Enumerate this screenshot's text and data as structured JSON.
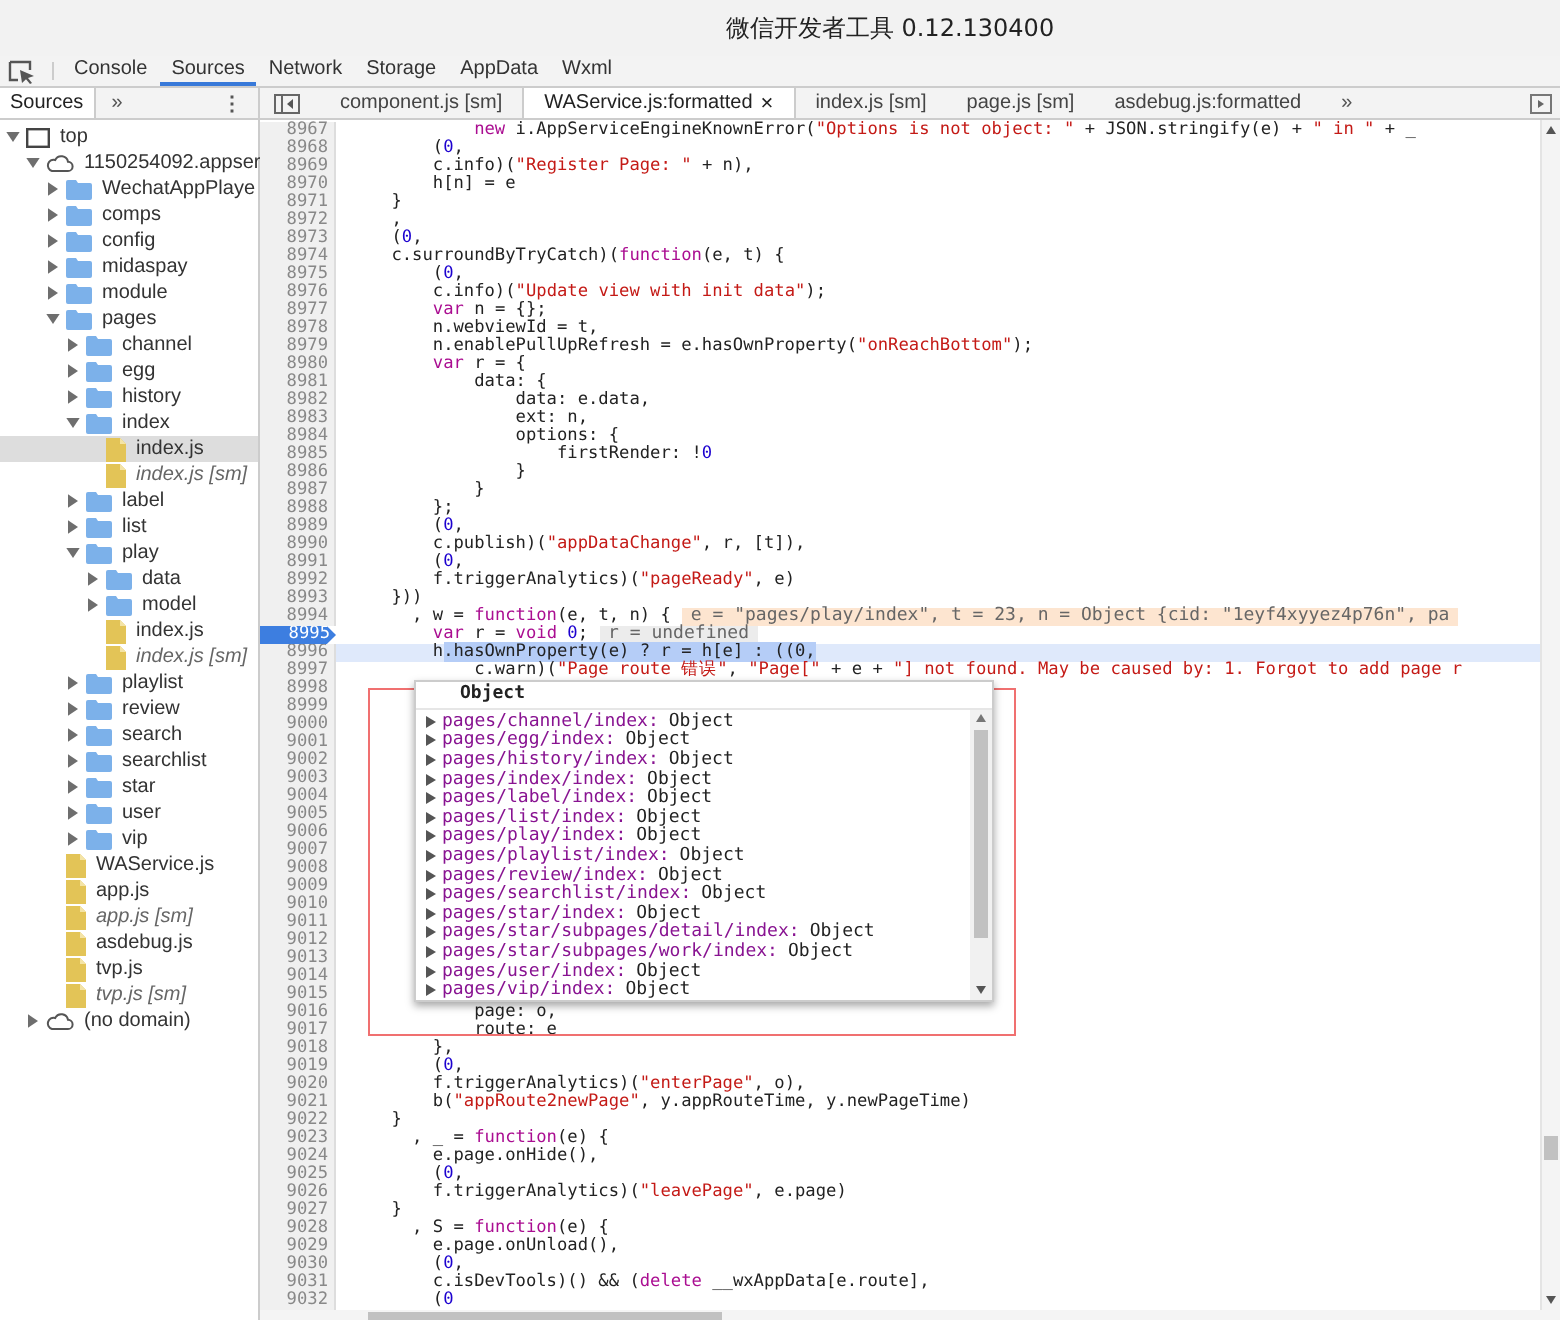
{
  "window": {
    "title": "微信开发者工具 0.12.130400"
  },
  "toolbar": {
    "tabs": [
      {
        "label": "Console",
        "selected": false
      },
      {
        "label": "Sources",
        "selected": true
      },
      {
        "label": "Network",
        "selected": false
      },
      {
        "label": "Storage",
        "selected": false
      },
      {
        "label": "AppData",
        "selected": false
      },
      {
        "label": "Wxml",
        "selected": false
      }
    ]
  },
  "navigator": {
    "tabs": [
      {
        "label": "Sources",
        "selected": true
      }
    ],
    "more": "»",
    "menu": "⋮",
    "tree": [
      {
        "label": "top",
        "kind": "frame",
        "expanded": true,
        "selected": false,
        "children": [
          {
            "label": "1150254092.appser",
            "kind": "domain",
            "expanded": true,
            "selected": false,
            "children": [
              {
                "label": "WechatAppPlaye",
                "kind": "folder",
                "expanded": false,
                "selected": false
              },
              {
                "label": "comps",
                "kind": "folder",
                "expanded": false,
                "selected": false
              },
              {
                "label": "config",
                "kind": "folder",
                "expanded": false,
                "selected": false
              },
              {
                "label": "midaspay",
                "kind": "folder",
                "expanded": false,
                "selected": false
              },
              {
                "label": "module",
                "kind": "folder",
                "expanded": false,
                "selected": false
              },
              {
                "label": "pages",
                "kind": "folder",
                "expanded": true,
                "selected": false,
                "children": [
                  {
                    "label": "channel",
                    "kind": "folder",
                    "expanded": false,
                    "selected": false
                  },
                  {
                    "label": "egg",
                    "kind": "folder",
                    "expanded": false,
                    "selected": false
                  },
                  {
                    "label": "history",
                    "kind": "folder",
                    "expanded": false,
                    "selected": false
                  },
                  {
                    "label": "index",
                    "kind": "folder",
                    "expanded": true,
                    "selected": false,
                    "children": [
                      {
                        "label": "index.js",
                        "kind": "file",
                        "selected": true
                      },
                      {
                        "label": "index.js [sm]",
                        "kind": "mapped-file",
                        "selected": false
                      }
                    ]
                  },
                  {
                    "label": "label",
                    "kind": "folder",
                    "expanded": false,
                    "selected": false
                  },
                  {
                    "label": "list",
                    "kind": "folder",
                    "expanded": false,
                    "selected": false
                  },
                  {
                    "label": "play",
                    "kind": "folder",
                    "expanded": true,
                    "selected": false,
                    "children": [
                      {
                        "label": "data",
                        "kind": "folder",
                        "expanded": false,
                        "selected": false
                      },
                      {
                        "label": "model",
                        "kind": "folder",
                        "expanded": false,
                        "selected": false
                      },
                      {
                        "label": "index.js",
                        "kind": "file",
                        "selected": false
                      },
                      {
                        "label": "index.js [sm]",
                        "kind": "mapped-file",
                        "selected": false
                      }
                    ]
                  },
                  {
                    "label": "playlist",
                    "kind": "folder",
                    "expanded": false,
                    "selected": false
                  },
                  {
                    "label": "review",
                    "kind": "folder",
                    "expanded": false,
                    "selected": false
                  },
                  {
                    "label": "search",
                    "kind": "folder",
                    "expanded": false,
                    "selected": false
                  },
                  {
                    "label": "searchlist",
                    "kind": "folder",
                    "expanded": false,
                    "selected": false
                  },
                  {
                    "label": "star",
                    "kind": "folder",
                    "expanded": false,
                    "selected": false
                  },
                  {
                    "label": "user",
                    "kind": "folder",
                    "expanded": false,
                    "selected": false
                  },
                  {
                    "label": "vip",
                    "kind": "folder",
                    "expanded": false,
                    "selected": false
                  }
                ]
              },
              {
                "label": "WAService.js",
                "kind": "file",
                "selected": false
              },
              {
                "label": "app.js",
                "kind": "file",
                "selected": false
              },
              {
                "label": "app.js [sm]",
                "kind": "mapped-file",
                "selected": false
              },
              {
                "label": "asdebug.js",
                "kind": "file",
                "selected": false
              },
              {
                "label": "tvp.js",
                "kind": "file",
                "selected": false
              },
              {
                "label": "tvp.js [sm]",
                "kind": "mapped-file",
                "selected": false
              }
            ]
          },
          {
            "label": "(no domain)",
            "kind": "domain",
            "expanded": false,
            "selected": false
          }
        ]
      }
    ]
  },
  "editor": {
    "tabs": [
      {
        "label": "component.js [sm]",
        "selected": false
      },
      {
        "label": "WAService.js:formatted",
        "selected": true,
        "close": "×"
      },
      {
        "label": "index.js [sm]",
        "selected": false
      },
      {
        "label": "page.js [sm]",
        "selected": false
      },
      {
        "label": "asdebug.js:formatted",
        "selected": false
      }
    ],
    "more": "»",
    "lines": [
      {
        "number": "8967",
        "breakpoint": false,
        "current": false,
        "tokens": [
          {
            "kind": "keyword",
            "text": "            new"
          },
          {
            "kind": "plain",
            "text": " i.AppServiceEngineKnownError("
          },
          {
            "kind": "string",
            "text": "\"Options is not object: \""
          },
          {
            "kind": "plain",
            "text": " + JSON.stringify(e) + "
          },
          {
            "kind": "string",
            "text": "\" in \""
          },
          {
            "kind": "plain",
            "text": " + _"
          }
        ]
      },
      {
        "number": "8968",
        "breakpoint": false,
        "current": false,
        "tokens": [
          {
            "kind": "plain",
            "text": "        ("
          },
          {
            "kind": "number",
            "text": "0"
          },
          {
            "kind": "plain",
            "text": ","
          }
        ]
      },
      {
        "number": "8969",
        "breakpoint": false,
        "current": false,
        "tokens": [
          {
            "kind": "plain",
            "text": "        c.info)("
          },
          {
            "kind": "string",
            "text": "\"Register Page: \""
          },
          {
            "kind": "plain",
            "text": " + n),"
          }
        ]
      },
      {
        "number": "8970",
        "breakpoint": false,
        "current": false,
        "tokens": [
          {
            "kind": "plain",
            "text": "        h[n] = e"
          }
        ]
      },
      {
        "number": "8971",
        "breakpoint": false,
        "current": false,
        "tokens": [
          {
            "kind": "plain",
            "text": "    }"
          }
        ]
      },
      {
        "number": "8972",
        "breakpoint": false,
        "current": false,
        "tokens": [
          {
            "kind": "plain",
            "text": "    ,"
          }
        ]
      },
      {
        "number": "8973",
        "breakpoint": false,
        "current": false,
        "tokens": [
          {
            "kind": "plain",
            "text": "    ("
          },
          {
            "kind": "number",
            "text": "0"
          },
          {
            "kind": "plain",
            "text": ","
          }
        ]
      },
      {
        "number": "8974",
        "breakpoint": false,
        "current": false,
        "tokens": [
          {
            "kind": "plain",
            "text": "    c.surroundByTryCatch)("
          },
          {
            "kind": "keyword",
            "text": "function"
          },
          {
            "kind": "plain",
            "text": "(e, t) {"
          }
        ]
      },
      {
        "number": "8975",
        "breakpoint": false,
        "current": false,
        "tokens": [
          {
            "kind": "plain",
            "text": "        ("
          },
          {
            "kind": "number",
            "text": "0"
          },
          {
            "kind": "plain",
            "text": ","
          }
        ]
      },
      {
        "number": "8976",
        "breakpoint": false,
        "current": false,
        "tokens": [
          {
            "kind": "plain",
            "text": "        c.info)("
          },
          {
            "kind": "string",
            "text": "\"Update view with init data\""
          },
          {
            "kind": "plain",
            "text": ");"
          }
        ]
      },
      {
        "number": "8977",
        "breakpoint": false,
        "current": false,
        "tokens": [
          {
            "kind": "keyword",
            "text": "        var"
          },
          {
            "kind": "plain",
            "text": " n = {};"
          }
        ]
      },
      {
        "number": "8978",
        "breakpoint": false,
        "current": false,
        "tokens": [
          {
            "kind": "plain",
            "text": "        n.webviewId = t,"
          }
        ]
      },
      {
        "number": "8979",
        "breakpoint": false,
        "current": false,
        "tokens": [
          {
            "kind": "plain",
            "text": "        n.enablePullUpRefresh = e.hasOwnProperty("
          },
          {
            "kind": "string",
            "text": "\"onReachBottom\""
          },
          {
            "kind": "plain",
            "text": ");"
          }
        ]
      },
      {
        "number": "8980",
        "breakpoint": false,
        "current": false,
        "tokens": [
          {
            "kind": "keyword",
            "text": "        var"
          },
          {
            "kind": "plain",
            "text": " r = {"
          }
        ]
      },
      {
        "number": "8981",
        "breakpoint": false,
        "current": false,
        "tokens": [
          {
            "kind": "plain",
            "text": "            data: {"
          }
        ]
      },
      {
        "number": "8982",
        "breakpoint": false,
        "current": false,
        "tokens": [
          {
            "kind": "plain",
            "text": "                data: e.data,"
          }
        ]
      },
      {
        "number": "8983",
        "breakpoint": false,
        "current": false,
        "tokens": [
          {
            "kind": "plain",
            "text": "                ext: n,"
          }
        ]
      },
      {
        "number": "8984",
        "breakpoint": false,
        "current": false,
        "tokens": [
          {
            "kind": "plain",
            "text": "                options: {"
          }
        ]
      },
      {
        "number": "8985",
        "breakpoint": false,
        "current": false,
        "tokens": [
          {
            "kind": "plain",
            "text": "                    firstRender: !"
          },
          {
            "kind": "number",
            "text": "0"
          }
        ]
      },
      {
        "number": "8986",
        "breakpoint": false,
        "current": false,
        "tokens": [
          {
            "kind": "plain",
            "text": "                }"
          }
        ]
      },
      {
        "number": "8987",
        "breakpoint": false,
        "current": false,
        "tokens": [
          {
            "kind": "plain",
            "text": "            }"
          }
        ]
      },
      {
        "number": "8988",
        "breakpoint": false,
        "current": false,
        "tokens": [
          {
            "kind": "plain",
            "text": "        };"
          }
        ]
      },
      {
        "number": "8989",
        "breakpoint": false,
        "current": false,
        "tokens": [
          {
            "kind": "plain",
            "text": "        ("
          },
          {
            "kind": "number",
            "text": "0"
          },
          {
            "kind": "plain",
            "text": ","
          }
        ]
      },
      {
        "number": "8990",
        "breakpoint": false,
        "current": false,
        "tokens": [
          {
            "kind": "plain",
            "text": "        c.publish)("
          },
          {
            "kind": "string",
            "text": "\"appDataChange\""
          },
          {
            "kind": "plain",
            "text": ", r, [t]),"
          }
        ]
      },
      {
        "number": "8991",
        "breakpoint": false,
        "current": false,
        "tokens": [
          {
            "kind": "plain",
            "text": "        ("
          },
          {
            "kind": "number",
            "text": "0"
          },
          {
            "kind": "plain",
            "text": ","
          }
        ]
      },
      {
        "number": "8992",
        "breakpoint": false,
        "current": false,
        "tokens": [
          {
            "kind": "plain",
            "text": "        f.triggerAnalytics)("
          },
          {
            "kind": "string",
            "text": "\"pageReady\""
          },
          {
            "kind": "plain",
            "text": ", e)"
          }
        ]
      },
      {
        "number": "8993",
        "breakpoint": false,
        "current": false,
        "tokens": [
          {
            "kind": "plain",
            "text": "    }))"
          }
        ]
      },
      {
        "number": "8994",
        "breakpoint": false,
        "current": false,
        "tokens": [
          {
            "kind": "plain",
            "text": "      , w = "
          },
          {
            "kind": "keyword",
            "text": "function"
          },
          {
            "kind": "plain",
            "text": "(e, t, n) {"
          }
        ],
        "annotation": {
          "kind": "arguments",
          "text": "e = \"pages/play/index\", t = 23, n = Object {cid: \"1eyf4xyyez4p76n\", pa"
        }
      },
      {
        "number": "8995",
        "breakpoint": true,
        "current": false,
        "tokens": [
          {
            "kind": "keyword",
            "text": "        var"
          },
          {
            "kind": "plain",
            "text": " r = "
          },
          {
            "kind": "keyword",
            "text": "void "
          },
          {
            "kind": "number",
            "text": "0"
          },
          {
            "kind": "plain",
            "text": ";"
          }
        ],
        "annotation": {
          "kind": "value",
          "text": "r = undefined"
        }
      },
      {
        "number": "8996",
        "breakpoint": false,
        "current": true,
        "tokens": [
          {
            "kind": "plain",
            "text": "        h"
          },
          {
            "kind": "selection",
            "text": ".hasOwnProperty(e) ? r = h[e] : ((0,"
          }
        ]
      },
      {
        "number": "8997",
        "breakpoint": false,
        "current": false,
        "tokens": [
          {
            "kind": "plain",
            "text": "            c.warn)("
          },
          {
            "kind": "string",
            "text": "\"Page route 错误\""
          },
          {
            "kind": "plain",
            "text": ", "
          },
          {
            "kind": "string",
            "text": "\"Page[\""
          },
          {
            "kind": "plain",
            "text": " + e + "
          },
          {
            "kind": "string",
            "text": "\"] not found. May be caused by: 1. Forgot to add page r"
          }
        ]
      },
      {
        "number": "8998",
        "breakpoint": false,
        "current": false
      },
      {
        "number": "8999",
        "breakpoint": false,
        "current": false
      },
      {
        "number": "9000",
        "breakpoint": false,
        "current": false
      },
      {
        "number": "9001",
        "breakpoint": false,
        "current": false
      },
      {
        "number": "9002",
        "breakpoint": false,
        "current": false
      },
      {
        "number": "9003",
        "breakpoint": false,
        "current": false
      },
      {
        "number": "9004",
        "breakpoint": false,
        "current": false
      },
      {
        "number": "9005",
        "breakpoint": false,
        "current": false
      },
      {
        "number": "9006",
        "breakpoint": false,
        "current": false
      },
      {
        "number": "9007",
        "breakpoint": false,
        "current": false
      },
      {
        "number": "9008",
        "breakpoint": false,
        "current": false
      },
      {
        "number": "9009",
        "breakpoint": false,
        "current": false
      },
      {
        "number": "9010",
        "breakpoint": false,
        "current": false
      },
      {
        "number": "9011",
        "breakpoint": false,
        "current": false
      },
      {
        "number": "9012",
        "breakpoint": false,
        "current": false
      },
      {
        "number": "9013",
        "breakpoint": false,
        "current": false
      },
      {
        "number": "9014",
        "breakpoint": false,
        "current": false
      },
      {
        "number": "9015",
        "breakpoint": false,
        "current": false
      },
      {
        "number": "9016",
        "breakpoint": false,
        "current": false,
        "tokens": [
          {
            "kind": "plain",
            "text": "            page: o,"
          }
        ]
      },
      {
        "number": "9017",
        "breakpoint": false,
        "current": false,
        "tokens": [
          {
            "kind": "plain",
            "text": "            route: e"
          }
        ]
      },
      {
        "number": "9018",
        "breakpoint": false,
        "current": false,
        "tokens": [
          {
            "kind": "plain",
            "text": "        },"
          }
        ]
      },
      {
        "number": "9019",
        "breakpoint": false,
        "current": false,
        "tokens": [
          {
            "kind": "plain",
            "text": "        ("
          },
          {
            "kind": "number",
            "text": "0"
          },
          {
            "kind": "plain",
            "text": ","
          }
        ]
      },
      {
        "number": "9020",
        "breakpoint": false,
        "current": false,
        "tokens": [
          {
            "kind": "plain",
            "text": "        f.triggerAnalytics)("
          },
          {
            "kind": "string",
            "text": "\"enterPage\""
          },
          {
            "kind": "plain",
            "text": ", o),"
          }
        ]
      },
      {
        "number": "9021",
        "breakpoint": false,
        "current": false,
        "tokens": [
          {
            "kind": "plain",
            "text": "        b("
          },
          {
            "kind": "string",
            "text": "\"appRoute2newPage\""
          },
          {
            "kind": "plain",
            "text": ", y.appRouteTime, y.newPageTime)"
          }
        ]
      },
      {
        "number": "9022",
        "breakpoint": false,
        "current": false,
        "tokens": [
          {
            "kind": "plain",
            "text": "    }"
          }
        ]
      },
      {
        "number": "9023",
        "breakpoint": false,
        "current": false,
        "tokens": [
          {
            "kind": "plain",
            "text": "      , _ = "
          },
          {
            "kind": "keyword",
            "text": "function"
          },
          {
            "kind": "plain",
            "text": "(e) {"
          }
        ]
      },
      {
        "number": "9024",
        "breakpoint": false,
        "current": false,
        "tokens": [
          {
            "kind": "plain",
            "text": "        e.page.onHide(),"
          }
        ]
      },
      {
        "number": "9025",
        "breakpoint": false,
        "current": false,
        "tokens": [
          {
            "kind": "plain",
            "text": "        ("
          },
          {
            "kind": "number",
            "text": "0"
          },
          {
            "kind": "plain",
            "text": ","
          }
        ]
      },
      {
        "number": "9026",
        "breakpoint": false,
        "current": false,
        "tokens": [
          {
            "kind": "plain",
            "text": "        f.triggerAnalytics)("
          },
          {
            "kind": "string",
            "text": "\"leavePage\""
          },
          {
            "kind": "plain",
            "text": ", e.page)"
          }
        ]
      },
      {
        "number": "9027",
        "breakpoint": false,
        "current": false,
        "tokens": [
          {
            "kind": "plain",
            "text": "    }"
          }
        ]
      },
      {
        "number": "9028",
        "breakpoint": false,
        "current": false,
        "tokens": [
          {
            "kind": "plain",
            "text": "      , S = "
          },
          {
            "kind": "keyword",
            "text": "function"
          },
          {
            "kind": "plain",
            "text": "(e) {"
          }
        ]
      },
      {
        "number": "9029",
        "breakpoint": false,
        "current": false,
        "tokens": [
          {
            "kind": "plain",
            "text": "        e.page.onUnload(),"
          }
        ]
      },
      {
        "number": "9030",
        "breakpoint": false,
        "current": false,
        "tokens": [
          {
            "kind": "plain",
            "text": "        ("
          },
          {
            "kind": "number",
            "text": "0"
          },
          {
            "kind": "plain",
            "text": ","
          }
        ]
      },
      {
        "number": "9031",
        "breakpoint": false,
        "current": false,
        "tokens": [
          {
            "kind": "plain",
            "text": "        c.isDevTools)() && ("
          },
          {
            "kind": "keyword",
            "text": "delete"
          },
          {
            "kind": "plain",
            "text": " __wxAppData[e.route],"
          }
        ]
      },
      {
        "number": "9032",
        "breakpoint": false,
        "current": false,
        "tokens": [
          {
            "kind": "plain",
            "text": "        ("
          },
          {
            "kind": "number",
            "text": "0"
          }
        ]
      }
    ],
    "popup": {
      "title": "Object",
      "rows": [
        {
          "key": "pages/channel/index:",
          "value": "Object"
        },
        {
          "key": "pages/egg/index:",
          "value": "Object"
        },
        {
          "key": "pages/history/index:",
          "value": "Object"
        },
        {
          "key": "pages/index/index:",
          "value": "Object"
        },
        {
          "key": "pages/label/index:",
          "value": "Object"
        },
        {
          "key": "pages/list/index:",
          "value": "Object"
        },
        {
          "key": "pages/play/index:",
          "value": "Object"
        },
        {
          "key": "pages/playlist/index:",
          "value": "Object"
        },
        {
          "key": "pages/review/index:",
          "value": "Object"
        },
        {
          "key": "pages/searchlist/index:",
          "value": "Object"
        },
        {
          "key": "pages/star/index:",
          "value": "Object"
        },
        {
          "key": "pages/star/subpages/detail/index:",
          "value": "Object"
        },
        {
          "key": "pages/star/subpages/work/index:",
          "value": "Object"
        },
        {
          "key": "pages/user/index:",
          "value": "Object"
        },
        {
          "key": "pages/vip/index:",
          "value": "Object"
        }
      ]
    }
  }
}
